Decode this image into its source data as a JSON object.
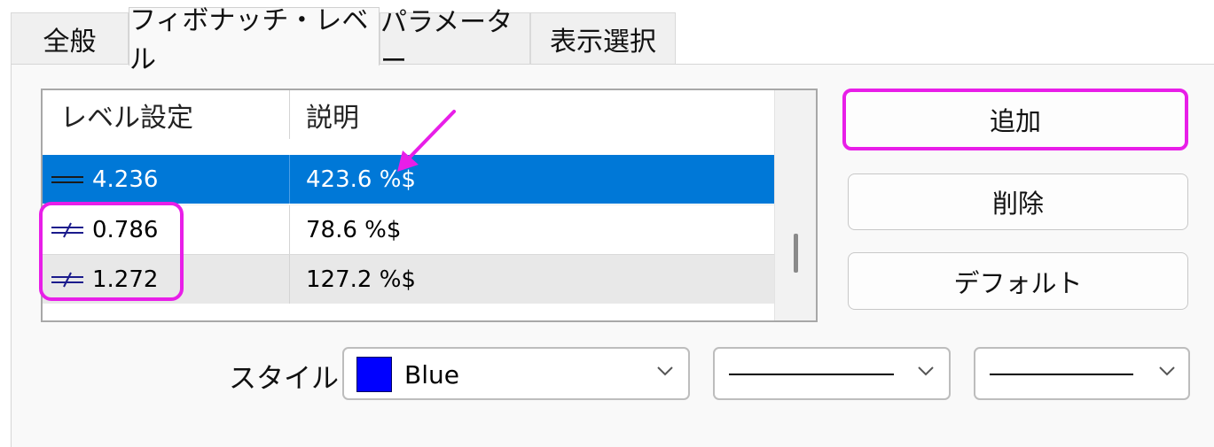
{
  "tabs": [
    {
      "label": "全般",
      "active": false
    },
    {
      "label": "フィボナッチ・レベル",
      "active": true
    },
    {
      "label": "パラメーター",
      "active": false
    },
    {
      "label": "表示選択",
      "active": false
    }
  ],
  "levels_table": {
    "columns": [
      "レベル設定",
      "説明"
    ],
    "rows": [
      {
        "level": "4.236",
        "description": "423.6 %$",
        "selected": true,
        "line_style_icon": "solid-line-icon"
      },
      {
        "level": "0.786",
        "description": "78.6 %$",
        "selected": false,
        "line_style_icon": "dashed-line-icon"
      },
      {
        "level": "1.272",
        "description": "127.2 %$",
        "selected": false,
        "line_style_icon": "dashed-line-icon"
      }
    ]
  },
  "buttons": {
    "add": "追加",
    "delete": "削除",
    "default": "デフォルト"
  },
  "style": {
    "label": "スタイル",
    "color_name": "Blue",
    "color_hex": "#0000ff",
    "line_width": "solid",
    "line_type": "solid"
  },
  "colors": {
    "selection": "#0078d7",
    "highlight_annotation": "#e81ee8"
  }
}
